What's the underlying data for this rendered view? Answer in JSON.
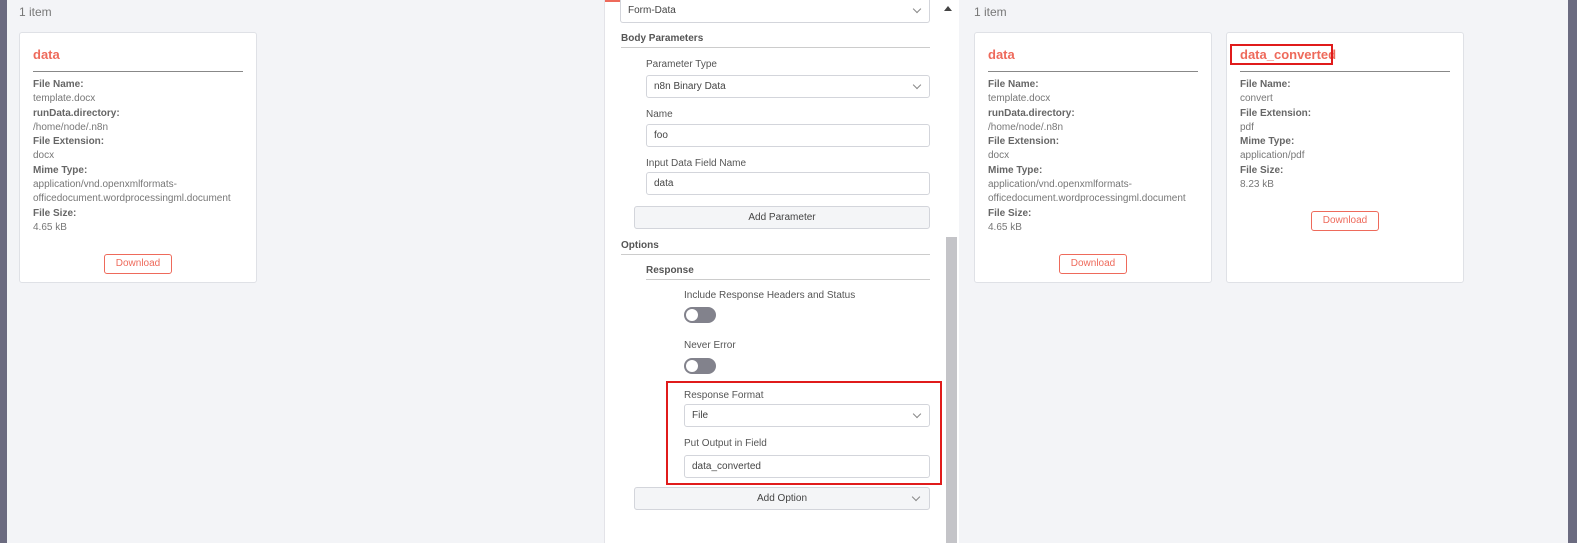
{
  "left": {
    "item_count": "1 item",
    "card": {
      "title": "data",
      "fields": [
        {
          "key": "File Name:",
          "value": "template.docx"
        },
        {
          "key": "runData.directory:",
          "value": "/home/node/.n8n"
        },
        {
          "key": "File Extension:",
          "value": "docx"
        },
        {
          "key": "Mime Type:",
          "value": "application/vnd.openxmlformats-officedocument.wordprocessingml.document"
        },
        {
          "key": "File Size:",
          "value": "4.65 kB"
        }
      ],
      "download_label": "Download"
    }
  },
  "panel": {
    "content_type_value": "Form-Data",
    "body_parameters_title": "Body Parameters",
    "parameter_type_label": "Parameter Type",
    "parameter_type_value": "n8n Binary Data",
    "name_label": "Name",
    "name_value": "foo",
    "input_field_label": "Input Data Field Name",
    "input_field_value": "data",
    "add_parameter_label": "Add Parameter",
    "options_title": "Options",
    "response_title": "Response",
    "include_headers_label": "Include Response Headers and Status",
    "include_headers_on": false,
    "never_error_label": "Never Error",
    "never_error_on": false,
    "response_format_label": "Response Format",
    "response_format_value": "File",
    "output_field_label": "Put Output in Field",
    "output_field_value": "data_converted",
    "add_option_label": "Add Option"
  },
  "right": {
    "item_count": "1 item",
    "cards": [
      {
        "title": "data",
        "fields": [
          {
            "key": "File Name:",
            "value": "template.docx"
          },
          {
            "key": "runData.directory:",
            "value": "/home/node/.n8n"
          },
          {
            "key": "File Extension:",
            "value": "docx"
          },
          {
            "key": "Mime Type:",
            "value": "application/vnd.openxmlformats-officedocument.wordprocessingml.document"
          },
          {
            "key": "File Size:",
            "value": "4.65 kB"
          }
        ],
        "download_label": "Download"
      },
      {
        "title": "data_converted",
        "fields": [
          {
            "key": "File Name:",
            "value": "convert"
          },
          {
            "key": "File Extension:",
            "value": "pdf"
          },
          {
            "key": "Mime Type:",
            "value": "application/pdf"
          },
          {
            "key": "File Size:",
            "value": "8.23 kB"
          }
        ],
        "download_label": "Download"
      }
    ]
  },
  "colors": {
    "accent": "#ee6a5b",
    "highlight": "#e01b1b",
    "background": "#f3f4f7"
  }
}
